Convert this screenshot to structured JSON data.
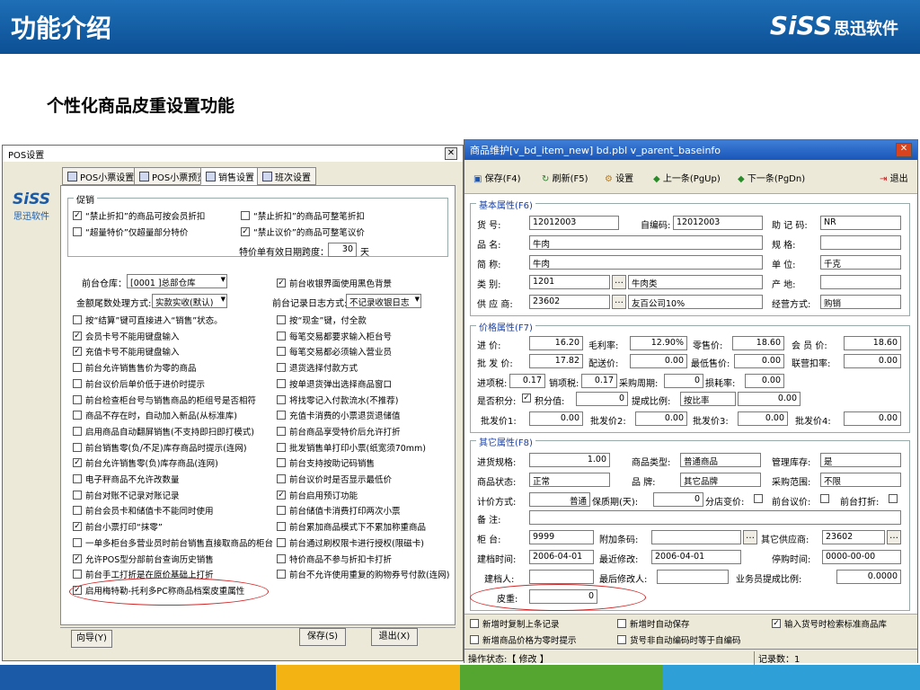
{
  "slide": {
    "title": "功能介绍",
    "brand_latin": "SiSS",
    "brand_cn": "思迅软件",
    "subtitle": "个性化商品皮重设置功能"
  },
  "pos_window": {
    "title": "POS设置",
    "logo_latin": "SiSS",
    "logo_cn": "思迅软件",
    "tabs": [
      "POS小票设置",
      "POS小票预览",
      "销售设置",
      "班次设置"
    ],
    "promo_label": "促销",
    "promo": [
      {
        "label": "“禁止折扣”的商品可按会员折扣",
        "checked": true
      },
      {
        "label": "“禁止折扣”的商品可整笔折扣",
        "checked": false
      },
      {
        "label": "“超量特价”仅超量部分特价",
        "checked": false
      },
      {
        "label": "“禁止议价”的商品可整笔议价",
        "checked": true
      }
    ],
    "special_days_label": "特价单有效日期跨度：",
    "special_days": "30",
    "special_days_unit": "天",
    "warehouse_label": "前台仓库：",
    "warehouse": "[0001 ]总部仓库",
    "black_bg": {
      "label": "前台收银界面使用黑色背景",
      "checked": true
    },
    "rounding_label": "金额尾数处理方式:",
    "rounding": "实款实收(默认)",
    "log_label": "前台记录日志方式:",
    "log": "不记录收银日志",
    "left_opts": [
      {
        "label": "按“结算”键可直接进入“销售”状态。",
        "checked": false
      },
      {
        "label": "会员卡号不能用键盘输入",
        "checked": true
      },
      {
        "label": "充值卡号不能用键盘输入",
        "checked": true
      },
      {
        "label": "前台允许销售售价为零的商品",
        "checked": false
      },
      {
        "label": "前台议价后单价低于进价时提示",
        "checked": false
      },
      {
        "label": "前台检查柜台号与销售商品的柜组号是否相符",
        "checked": false
      },
      {
        "label": "商品不存在时，自动加入新品(从标准库)",
        "checked": false
      },
      {
        "label": "启用商品自动翻屏销售(不支持即扫即打模式)",
        "checked": false
      },
      {
        "label": "前台销售零(负/不足)库存商品时提示(连网)",
        "checked": false
      },
      {
        "label": "前台允许销售零(负)库存商品(连网)",
        "checked": true
      },
      {
        "label": "电子秤商品不允许改数量",
        "checked": false
      },
      {
        "label": "前台对账不记录对账记录",
        "checked": false
      },
      {
        "label": "前台会员卡和储值卡不能同时使用",
        "checked": false
      },
      {
        "label": "前台小票打印“抹零”",
        "checked": true
      },
      {
        "label": "一单多柜台多营业员时前台销售直接取商品的柜台",
        "checked": false
      },
      {
        "label": "允许POS型分部前台查询历史销售",
        "checked": true
      },
      {
        "label": "前台手工打折是在原价基础上打折",
        "checked": false
      },
      {
        "label": "启用梅特勒-托利多PC称商品档案皮重属性",
        "checked": true
      }
    ],
    "right_opts": [
      {
        "label": "按“现金”键，付全款",
        "checked": false
      },
      {
        "label": "每笔交易都要求输入柜台号",
        "checked": false
      },
      {
        "label": "每笔交易都必须输入营业员",
        "checked": false
      },
      {
        "label": "退货选择付款方式",
        "checked": false
      },
      {
        "label": "按单退货弹出选择商品窗口",
        "checked": false
      },
      {
        "label": "将找零记入付款流水(不推荐)",
        "checked": false
      },
      {
        "label": "充值卡消费的小票退货退储值",
        "checked": false
      },
      {
        "label": "前台商品享受特价后允许打折",
        "checked": false
      },
      {
        "label": "批发销售单打印小票(纸宽须70mm)",
        "checked": false
      },
      {
        "label": "前台支持按助记码销售",
        "checked": false
      },
      {
        "label": "前台议价时是否显示最低价",
        "checked": false
      },
      {
        "label": "前台启用预订功能",
        "checked": true
      },
      {
        "label": "前台储值卡消费打印两次小票",
        "checked": false
      },
      {
        "label": "前台累加商品模式下不累加称重商品",
        "checked": false
      },
      {
        "label": "前台通过刷权限卡进行授权(限磁卡)",
        "checked": false
      },
      {
        "label": "特价商品不参与折扣卡打折",
        "checked": false
      },
      {
        "label": "前台不允许使用重复的购物券号付款(连网)",
        "checked": false
      }
    ],
    "buttons": {
      "wizard": "向导(Y)",
      "save": "保存(S)",
      "exit": "退出(X)"
    }
  },
  "item_window": {
    "title": "商品维护[v_bd_item_new] bd.pbl v_parent_baseinfo",
    "toolbar": {
      "save": "保存(F4)",
      "refresh": "刷新(F5)",
      "settings": "设置",
      "prev": "上一条(PgUp)",
      "next": "下一条(PgDn)",
      "exit": "退出"
    },
    "basic_title": "基本属性(F6)",
    "basic": {
      "code_label": "货    号:",
      "code": "12012003",
      "selfcode_label": "自编码:",
      "selfcode": "12012003",
      "mnemonic_label": "助 记 码:",
      "mnemonic": "NR",
      "name_label": "品    名:",
      "name": "牛肉",
      "spec_label": "规      格:",
      "spec": "",
      "short_label": "简    称:",
      "short": "牛肉",
      "unit_label": "单      位:",
      "unit": "千克",
      "category_label": "类    别:",
      "category_code": "1201",
      "category_name": "牛肉类",
      "origin_label": "产      地:",
      "origin": "",
      "supplier_label": "供 应 商:",
      "supplier_code": "23602",
      "supplier_name": "友百公司10%",
      "mode_label": "经营方式:",
      "mode": "购销"
    },
    "price_title": "价格属性(F7)",
    "price": {
      "purchase_label": "进    价:",
      "purchase": "16.20",
      "margin_label": "毛利率:",
      "margin": "12.90%",
      "retail_label": "零售价:",
      "retail": "18.60",
      "member_label": "会 员 价:",
      "member": "18.60",
      "wholesale_label": "批 发 价:",
      "wholesale": "17.82",
      "dist_label": "配送价:",
      "dist": "0.00",
      "min_label": "最低售价:",
      "min": "0.00",
      "joint_label": "联营扣率:",
      "joint": "0.00",
      "intax_label": "进项税:",
      "intax": "0.17",
      "outtax_label": "销项税:",
      "outtax": "0.17",
      "period_label": "采购周期:",
      "period": "0",
      "loss_label": "损耗率:",
      "loss": "0.00",
      "points_label": "是否积分:",
      "points_checked": true,
      "pointval_label": "积分值:",
      "pointval": "0",
      "commission_label": "提成比例:",
      "commission": "按比率",
      "commission_val": "0.00",
      "wp1_label": "批发价1:",
      "wp1": "0.00",
      "wp2_label": "批发价2:",
      "wp2": "0.00",
      "wp3_label": "批发价3:",
      "wp3": "0.00",
      "wp4_label": "批发价4:",
      "wp4": "0.00"
    },
    "other_title": "其它属性(F8)",
    "other": {
      "pack_label": "进货规格:",
      "pack": "1.00",
      "type_label": "商品类型:",
      "type": "普通商品",
      "stock_label": "管理库存:",
      "stock": "是",
      "status_label": "商品状态:",
      "status": "正常",
      "brand_label": "品      牌:",
      "brand": "其它品牌",
      "scope_label": "采购范围:",
      "scope": "不限",
      "pricing_label": "计价方式:",
      "pricing": "普通",
      "shelf_label": "保质期(天):",
      "shelf": "0",
      "store_price_label": "分店变价:",
      "pos_bargain_label": "前台议价:",
      "pos_discount_label": "前台打折:",
      "note_label": "备    注:",
      "note": "",
      "counter_label": "柜    台:",
      "counter": "9999",
      "barcode_label": "附加条码:",
      "barcode": "",
      "other_sup_label": "其它供应商:",
      "other_sup": "23602",
      "created_label": "建档时间:",
      "created": "2006-04-01",
      "modified_label": "最近修改:",
      "modified": "2006-04-01",
      "stopped_label": "停购时间:",
      "stopped": "0000-00-00",
      "creator_label": "建档人:",
      "creator": "",
      "modifier_label": "最后修改人:",
      "modifier": "",
      "staff_label": "业务员提成比例:",
      "staff": "0.0000",
      "tare_label": "皮重:",
      "tare": "0"
    },
    "footer_opts": [
      {
        "label": "新增时复制上条记录",
        "checked": false
      },
      {
        "label": "新增时自动保存",
        "checked": false
      },
      {
        "label": "输入货号时检索标准商品库",
        "checked": true
      },
      {
        "label": "新增商品价格为零时提示",
        "checked": false
      },
      {
        "label": "货号非自动编码时等于自编码",
        "checked": false
      }
    ],
    "status_state": "操作状态:【 修改 】",
    "status_count": "记录数：1"
  }
}
